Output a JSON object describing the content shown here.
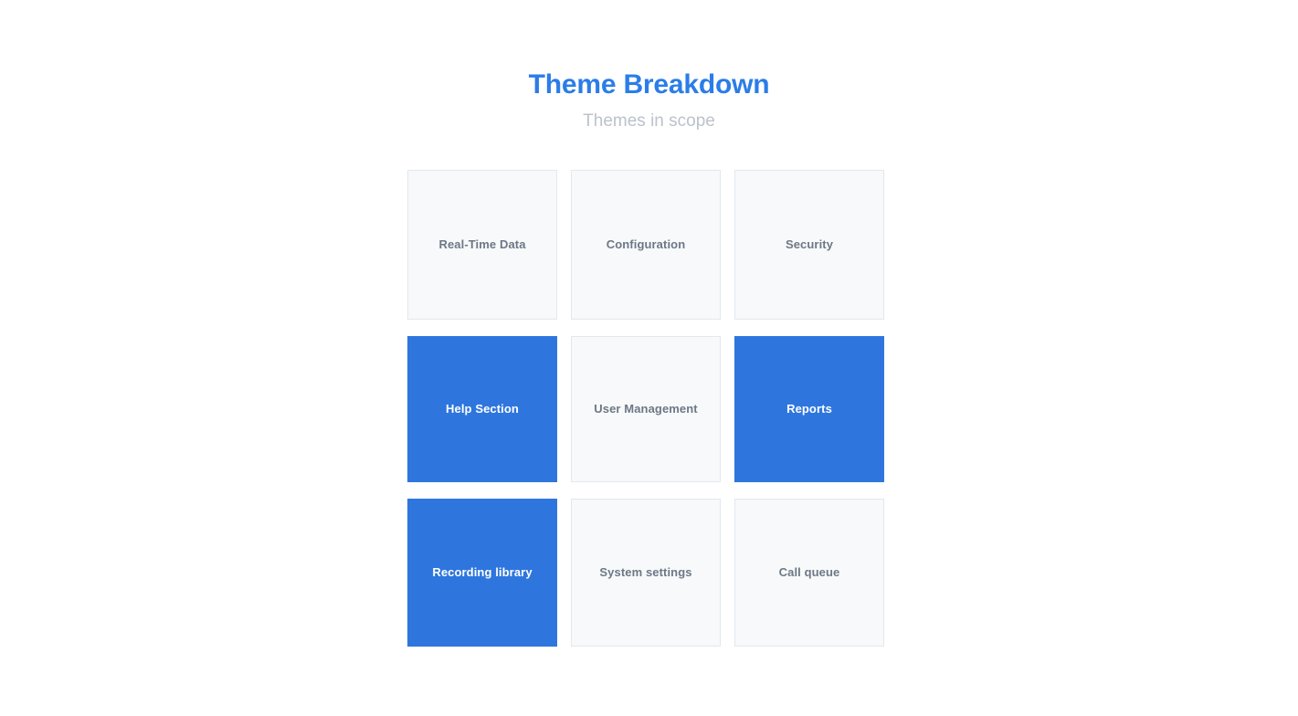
{
  "header": {
    "title": "Theme Breakdown",
    "subtitle": "Themes in scope"
  },
  "colors": {
    "title_blue": "#2b7de8",
    "subtitle_gray": "#bcc2cb",
    "cell_selected_blue": "#2e76de",
    "cell_idle_background": "#f7f9fa",
    "cell_idle_border": "#e3e8ee",
    "cell_idle_text": "#6d7886",
    "cell_selected_text": "#ffffff",
    "page_background": "#ffffff"
  },
  "grid": {
    "columns": 3,
    "rows": 3,
    "cells": [
      {
        "label": "Real-Time Data",
        "state": "inactive",
        "row": 1,
        "column": 1
      },
      {
        "label": "Configuration",
        "state": "inactive",
        "row": 1,
        "column": 2
      },
      {
        "label": "Security",
        "state": "inactive",
        "row": 1,
        "column": 3
      },
      {
        "label": "Help Section",
        "state": "active",
        "row": 2,
        "column": 1
      },
      {
        "label": "User Management",
        "state": "inactive",
        "row": 2,
        "column": 2
      },
      {
        "label": "Reports",
        "state": "active",
        "row": 2,
        "column": 3
      },
      {
        "label": "Recording library",
        "state": "active",
        "row": 3,
        "column": 1
      },
      {
        "label": "System settings",
        "state": "inactive",
        "row": 3,
        "column": 2
      },
      {
        "label": "Call queue",
        "state": "inactive",
        "row": 3,
        "column": 3
      }
    ]
  }
}
